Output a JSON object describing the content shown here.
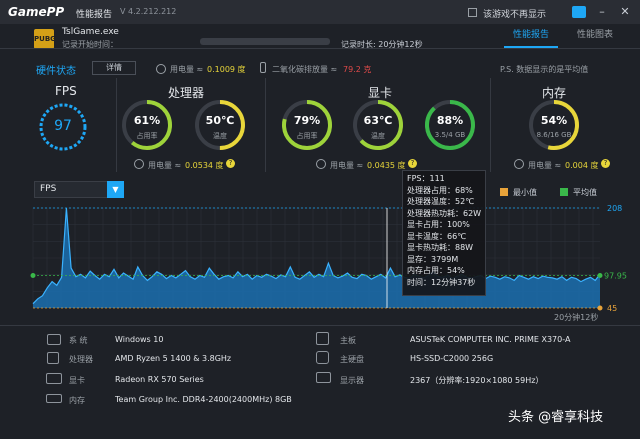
{
  "app": {
    "logo": "GamePP",
    "title": "性能报告",
    "version": "V 4.2.212.212",
    "checkbox_label": "该游戏不再显示"
  },
  "header": {
    "game_icon_text": "PUBG",
    "game_name": "TslGame.exe",
    "record_start": "记录开始时间：",
    "record_duration": "记录时长: 20分钟12秒",
    "tabs": [
      "性能报告",
      "性能图表"
    ]
  },
  "status": {
    "hw_status": "硬件状态",
    "detail_button": "详情",
    "power_total": "用电量 ≈",
    "power_total_value": "0.1009 度",
    "co2_label": "二氧化碳排放量 ≈",
    "co2_value": "79.2 克",
    "data_note": "P.S. 数据显示的是平均值"
  },
  "panels": {
    "fps": {
      "title": "FPS",
      "value": "97"
    },
    "cpu": {
      "title": "处理器",
      "usage": {
        "value": "61%",
        "label": "占用率",
        "pct": 0.61
      },
      "temp": {
        "value": "50℃",
        "label": "温度",
        "pct": 0.5
      },
      "power_label": "用电量 ≈",
      "power_value": "0.0534 度"
    },
    "gpu": {
      "title": "显卡",
      "usage": {
        "value": "79%",
        "label": "占用率",
        "pct": 0.79
      },
      "temp": {
        "value": "63℃",
        "label": "温度",
        "pct": 0.63
      },
      "vram": {
        "value": "88%",
        "label": "3.5/4 GB",
        "pct": 0.88
      },
      "power_label": "用电量 ≈",
      "power_value": "0.0435 度"
    },
    "mem": {
      "title": "内存",
      "usage": {
        "value": "54%",
        "label": "8.6/16 GB",
        "pct": 0.54
      },
      "power_label": "用电量 ≈",
      "power_value": "0.004 度"
    }
  },
  "chart": {
    "selected": "FPS",
    "legend": [
      {
        "name": "最小值",
        "color": "#e8a33a"
      },
      {
        "name": "平均值",
        "color": "#3ab84a"
      }
    ]
  },
  "chart_data": {
    "type": "area",
    "title": "",
    "xlabel": "",
    "ylabel": "",
    "ylim": [
      45,
      208
    ],
    "reference_lines": {
      "max": 208,
      "avg": 97.95,
      "min": 45
    },
    "x_end_label": "20分钟12秒",
    "values": [
      52,
      60,
      65,
      78,
      88,
      82,
      95,
      208,
      110,
      96,
      100,
      94,
      105,
      98,
      92,
      100,
      96,
      108,
      94,
      102,
      97,
      92,
      112,
      98,
      90,
      96,
      104,
      100,
      93,
      98,
      94,
      100,
      106,
      96,
      92,
      98,
      95,
      110,
      100,
      92,
      96,
      98,
      94,
      104,
      96,
      100,
      92,
      98,
      95,
      100,
      97,
      93,
      99,
      96,
      112,
      95,
      92,
      98,
      104,
      95,
      100,
      96,
      118,
      98,
      94,
      97,
      102,
      95,
      93,
      100,
      98,
      92,
      96,
      100,
      94,
      110,
      96,
      99,
      95,
      93,
      100,
      97,
      94,
      98,
      104,
      96,
      95,
      99,
      93,
      97,
      100,
      95,
      94,
      96,
      98,
      93,
      97,
      95,
      92,
      96,
      94,
      90,
      98,
      95,
      92,
      96,
      93,
      97,
      95,
      94,
      92,
      96,
      90,
      95,
      93,
      88,
      92,
      95,
      90,
      100
    ]
  },
  "tooltip": [
    "FPS：111",
    "处理器占用：68%",
    "处理器温度：52℃",
    "处理器热功耗：62W",
    "显卡占用：100%",
    "显卡温度：66℃",
    "显卡热功耗：88W",
    "显存：3799M",
    "内存占用：54%",
    "时间：12分钟37秒"
  ],
  "specs": [
    {
      "label": "系    统",
      "value": "Windows 10",
      "icon": "monitor-icon"
    },
    {
      "label": "处理器",
      "value": "AMD Ryzen 5 1400 & 3.8GHz",
      "icon": "cpu-icon"
    },
    {
      "label": "显卡",
      "value": "Radeon RX 570 Series",
      "icon": "gpu-icon"
    },
    {
      "label": "内存",
      "value": "Team Group Inc. DDR4-2400(2400MHz) 8GB",
      "icon": "ram-icon"
    },
    {
      "label": "主板",
      "value": "ASUSTeK COMPUTER INC. PRIME X370-A",
      "icon": "motherboard-icon"
    },
    {
      "label": "主硬盘",
      "value": "HS-SSD-C2000 256G",
      "icon": "disk-icon"
    },
    {
      "label": "显示器",
      "value": "2367（分辨率:1920×1080 59Hz）",
      "icon": "display-icon"
    }
  ],
  "watermark": "头条 @睿享科技"
}
